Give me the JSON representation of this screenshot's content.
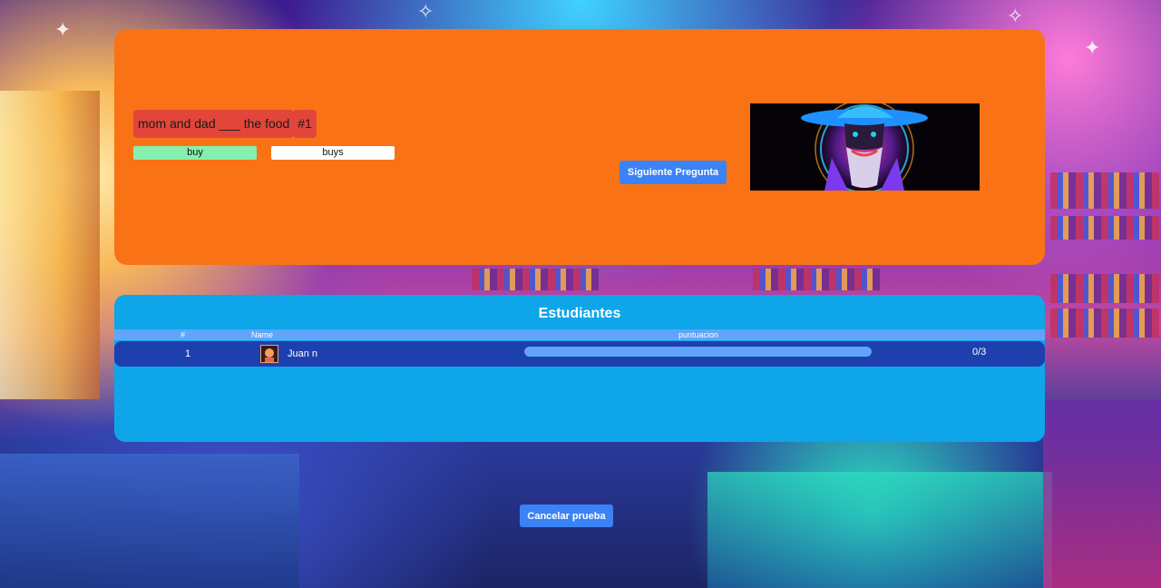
{
  "question": {
    "text": "mom and dad ___ the food",
    "number": "#1",
    "options": [
      {
        "label": "buy",
        "state": "correct"
      },
      {
        "label": "buys",
        "state": "normal"
      }
    ],
    "next_button": "Siguiente Pregunta"
  },
  "students": {
    "title": "Estudiantes",
    "columns": [
      "#",
      "Name",
      "puntuacion"
    ],
    "rows": [
      {
        "index": "1",
        "name": "Juan n",
        "score": "0/3",
        "progress": 1.0
      }
    ]
  },
  "cancel_button": "Cancelar prueba",
  "colors": {
    "question_panel": "#f97316",
    "students_panel": "#0ea5e9",
    "button": "#3b82f6",
    "correct_option": "#86efac"
  }
}
